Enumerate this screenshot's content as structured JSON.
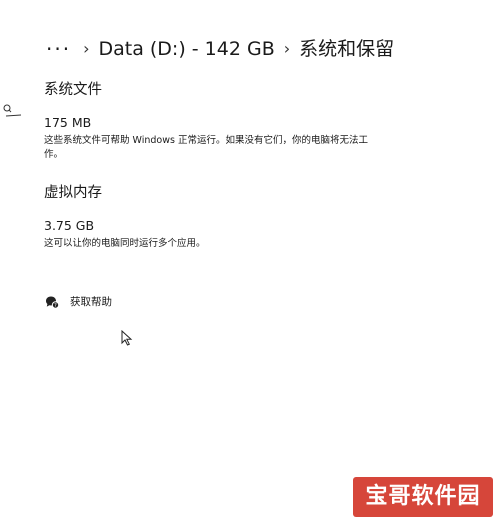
{
  "breadcrumb": {
    "more": "···",
    "parent": "Data (D:) - 142 GB",
    "current": "系统和保留"
  },
  "system_files": {
    "title": "系统文件",
    "size": "175 MB",
    "description": "这些系统文件可帮助 Windows 正常运行。如果没有它们，你的电脑将无法工作。"
  },
  "virtual_memory": {
    "title": "虚拟内存",
    "size": "3.75 GB",
    "description": "这可以让你的电脑同时运行多个应用。"
  },
  "help": {
    "label": "获取帮助",
    "icon": "help-chat-icon"
  },
  "watermark": {
    "text": "宝哥软件园"
  },
  "colors": {
    "watermark": "#d6463a",
    "text": "#1a1a1a"
  }
}
